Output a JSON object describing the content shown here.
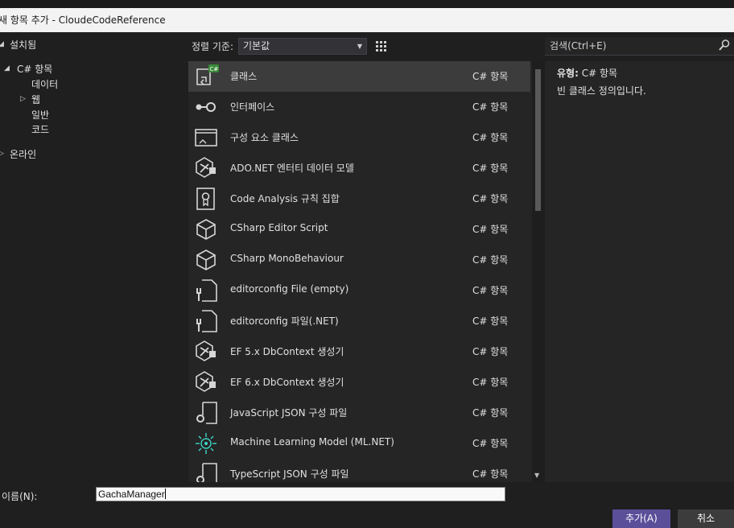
{
  "window": {
    "title": "새 항목 추가 - CloudeCodeReference"
  },
  "tree": {
    "installed": "설치됨",
    "csharp": "C# 항목",
    "data": "데이터",
    "web": "웹",
    "general": "일반",
    "code": "코드",
    "online": "온라인"
  },
  "toolbar": {
    "sort_label": "정렬 기준:",
    "sort_value": "기본값",
    "grid_view": "grid-view-icon",
    "list_view": "list-view-icon"
  },
  "search": {
    "placeholder": "검색(Ctrl+E)"
  },
  "templates": [
    {
      "name": "클래스",
      "category": "C# 항목",
      "icon": "class-icon"
    },
    {
      "name": "인터페이스",
      "category": "C# 항목",
      "icon": "interface-icon"
    },
    {
      "name": "구성 요소 클래스",
      "category": "C# 항목",
      "icon": "component-class-icon"
    },
    {
      "name": "ADO.NET 엔터티 데이터 모델",
      "category": "C# 항목",
      "icon": "entity-model-icon"
    },
    {
      "name": "Code Analysis 규칙 집합",
      "category": "C# 항목",
      "icon": "ruleset-icon"
    },
    {
      "name": "CSharp Editor Script",
      "category": "C# 항목",
      "icon": "cube-icon"
    },
    {
      "name": "CSharp MonoBehaviour",
      "category": "C# 항목",
      "icon": "cube-icon"
    },
    {
      "name": "editorconfig File (empty)",
      "category": "C# 항목",
      "icon": "editorconfig-icon"
    },
    {
      "name": "editorconfig 파일(.NET)",
      "category": "C# 항목",
      "icon": "editorconfig-icon"
    },
    {
      "name": "EF 5.x DbContext 생성기",
      "category": "C# 항목",
      "icon": "entity-model-icon"
    },
    {
      "name": "EF 6.x DbContext 생성기",
      "category": "C# 항목",
      "icon": "entity-model-icon"
    },
    {
      "name": "JavaScript JSON 구성 파일",
      "category": "C# 항목",
      "icon": "json-config-icon"
    },
    {
      "name": "Machine Learning Model (ML.NET)",
      "category": "C# 항목",
      "icon": "ml-model-icon"
    },
    {
      "name": "TypeScript JSON 구성 파일",
      "category": "C# 항목",
      "icon": "json-config-icon"
    }
  ],
  "details": {
    "type_label": "유형:",
    "type_value": "C# 항목",
    "description": "빈 클래스 정의입니다."
  },
  "footer": {
    "name_label": "이름(N):",
    "name_value": "GachaManager",
    "add_button": "추가(A)",
    "cancel_button": "취소"
  },
  "colors": {
    "background": "#1f1f1f",
    "panel": "#252526",
    "selected": "#3c3c3c",
    "accent": "#5b4f9a"
  }
}
